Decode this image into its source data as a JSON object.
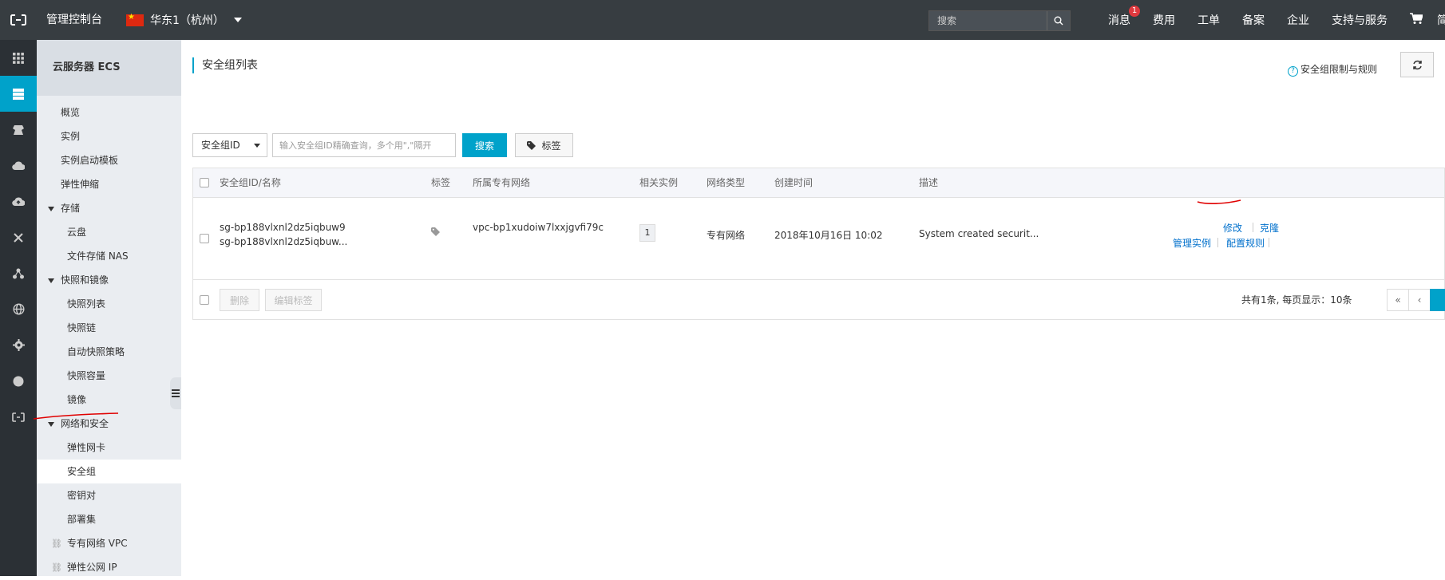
{
  "topbar": {
    "title": "管理控制台",
    "region": "华东1（杭州）",
    "search_placeholder": "搜索",
    "nav": [
      {
        "label": "消息",
        "badge": "1"
      },
      {
        "label": "费用"
      },
      {
        "label": "工单"
      },
      {
        "label": "备案"
      },
      {
        "label": "企业"
      },
      {
        "label": "支持与服务"
      },
      {
        "label": "简体"
      }
    ]
  },
  "sidebar": {
    "title": "云服务器 ECS",
    "items": {
      "overview": "概览",
      "instances": "实例",
      "launch_templates": "实例启动模板",
      "auto_scaling": "弹性伸缩",
      "storage": "存储",
      "disks": "云盘",
      "nas": "文件存储 NAS",
      "snapshots_images": "快照和镜像",
      "snapshot_list": "快照列表",
      "snapshot_chain": "快照链",
      "auto_snapshot_policy": "自动快照策略",
      "snapshot_capacity": "快照容量",
      "images": "镜像",
      "network_security": "网络和安全",
      "eni": "弹性网卡",
      "security_groups": "安全组",
      "key_pairs": "密钥对",
      "deployment_sets": "部署集",
      "vpc": "专有网络 VPC",
      "eip": "弹性公网 IP"
    }
  },
  "page": {
    "title": "安全组列表",
    "help_link": "安全组限制与规则"
  },
  "filter": {
    "select_value": "安全组ID",
    "input_placeholder": "输入安全组ID精确查询，多个用\",\"隔开",
    "search_label": "搜索",
    "tag_label": "标签"
  },
  "table": {
    "columns": [
      "安全组ID/名称",
      "标签",
      "所属专有网络",
      "相关实例",
      "网络类型",
      "创建时间",
      "描述"
    ],
    "rows": [
      {
        "id": "sg-bp188vlxnl2dz5iqbuw9",
        "name": "sg-bp188vlxnl2dz5iqbuw...",
        "vpc": "vpc-bp1xudoiw7lxxjgvfi79c",
        "instances": "1",
        "network_type": "专有网络",
        "created": "2018年10月16日 10:02",
        "description": "System created securit...",
        "actions": {
          "modify": "修改",
          "clone": "克隆",
          "manage_instances": "管理实例",
          "configure_rules": "配置规则"
        }
      }
    ],
    "footer": {
      "delete_label": "删除",
      "edit_tags_label": "编辑标签",
      "pagination_info": "共有1条, 每页显示：10条",
      "first": "«",
      "prev": "‹"
    }
  },
  "colors": {
    "topbar": "#373d41",
    "rail": "#2b3035",
    "accent": "#00a2ca",
    "link": "#0070cc",
    "annotation": "#e00000"
  }
}
